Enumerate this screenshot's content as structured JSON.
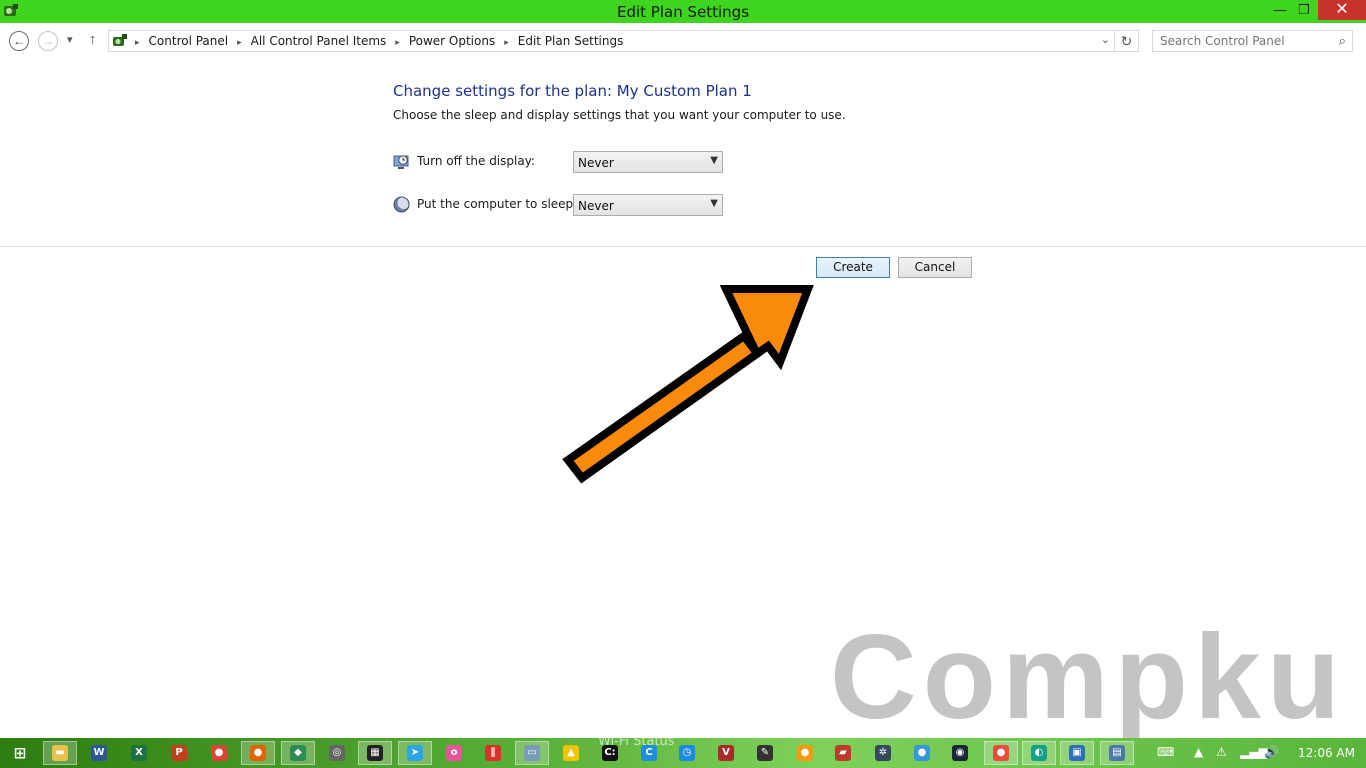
{
  "window": {
    "title": "Edit Plan Settings",
    "minimize": "—",
    "maximize": "❐",
    "close": "✕"
  },
  "nav": {
    "back": "←",
    "forward": "→",
    "recent": "▾",
    "up": "↑",
    "breadcrumbs": [
      "Control Panel",
      "All Control Panel Items",
      "Power Options",
      "Edit Plan Settings"
    ],
    "separator": "▸",
    "dropdown": "⌄",
    "refresh": "↻",
    "search_placeholder": "Search Control Panel",
    "search_icon": "⌕"
  },
  "main": {
    "heading": "Change settings for the plan: My Custom Plan 1",
    "subheading": "Choose the sleep and display settings that you want your computer to use.",
    "settings": [
      {
        "label": "Turn off the display:",
        "value": "Never",
        "icon": "monitor-clock-icon"
      },
      {
        "label": "Put the computer to sleep:",
        "value": "Never",
        "icon": "moon-icon"
      }
    ],
    "create_label": "Create",
    "cancel_label": "Cancel"
  },
  "watermark": "Compku",
  "taskbar": {
    "ghost_text": "Wi-Fi Status",
    "clock": "12:06 AM",
    "apps": [
      {
        "name": "start",
        "glyph": "⊞",
        "color": "#ffffff"
      },
      {
        "name": "file-explorer",
        "glyph": "▬",
        "color": "#e8c24a"
      },
      {
        "name": "word",
        "glyph": "W",
        "color": "#2b5797"
      },
      {
        "name": "excel",
        "glyph": "X",
        "color": "#1e7145"
      },
      {
        "name": "powerpoint",
        "glyph": "P",
        "color": "#c43e1c"
      },
      {
        "name": "chrome",
        "glyph": "●",
        "color": "#db4437"
      },
      {
        "name": "firefox",
        "glyph": "●",
        "color": "#e66000"
      },
      {
        "name": "app-globe",
        "glyph": "◆",
        "color": "#2e8b57"
      },
      {
        "name": "app-circle",
        "glyph": "◎",
        "color": "#666666"
      },
      {
        "name": "app-film",
        "glyph": "▦",
        "color": "#222222"
      },
      {
        "name": "telegram",
        "glyph": "➤",
        "color": "#2ca5e0"
      },
      {
        "name": "osu",
        "glyph": "o",
        "color": "#e2589b"
      },
      {
        "name": "app-red",
        "glyph": "∥",
        "color": "#d9322a"
      },
      {
        "name": "app-monitor",
        "glyph": "▭",
        "color": "#7a9bb5"
      },
      {
        "name": "app-warning",
        "glyph": "▲",
        "color": "#f5c400"
      },
      {
        "name": "cmd",
        "glyph": "C:",
        "color": "#111111"
      },
      {
        "name": "app-c",
        "glyph": "C",
        "color": "#1c8fd6"
      },
      {
        "name": "app-timer",
        "glyph": "◷",
        "color": "#1e88e5"
      },
      {
        "name": "app-v",
        "glyph": "V",
        "color": "#a72b2b"
      },
      {
        "name": "app-notes",
        "glyph": "✎",
        "color": "#333333"
      },
      {
        "name": "app-ball",
        "glyph": "●",
        "color": "#f39c12"
      },
      {
        "name": "app-book",
        "glyph": "▰",
        "color": "#c0392b"
      },
      {
        "name": "app-gear",
        "glyph": "✲",
        "color": "#34495e"
      },
      {
        "name": "app-earth",
        "glyph": "●",
        "color": "#3498db"
      },
      {
        "name": "steam",
        "glyph": "◉",
        "color": "#1b2838"
      },
      {
        "name": "app-chrome2",
        "glyph": "●",
        "color": "#e74c3c"
      },
      {
        "name": "app-paint",
        "glyph": "◐",
        "color": "#16a085"
      },
      {
        "name": "control-panel",
        "glyph": "▣",
        "color": "#2f6fb5"
      },
      {
        "name": "app-window",
        "glyph": "▤",
        "color": "#4a78a8"
      }
    ],
    "tray": [
      {
        "name": "keyboard",
        "glyph": "⌨"
      },
      {
        "name": "tray-expand",
        "glyph": "▲"
      },
      {
        "name": "tray-warning",
        "glyph": "⚠"
      },
      {
        "name": "signal",
        "glyph": "▂▄▆"
      },
      {
        "name": "volume",
        "glyph": "🔊"
      }
    ]
  }
}
